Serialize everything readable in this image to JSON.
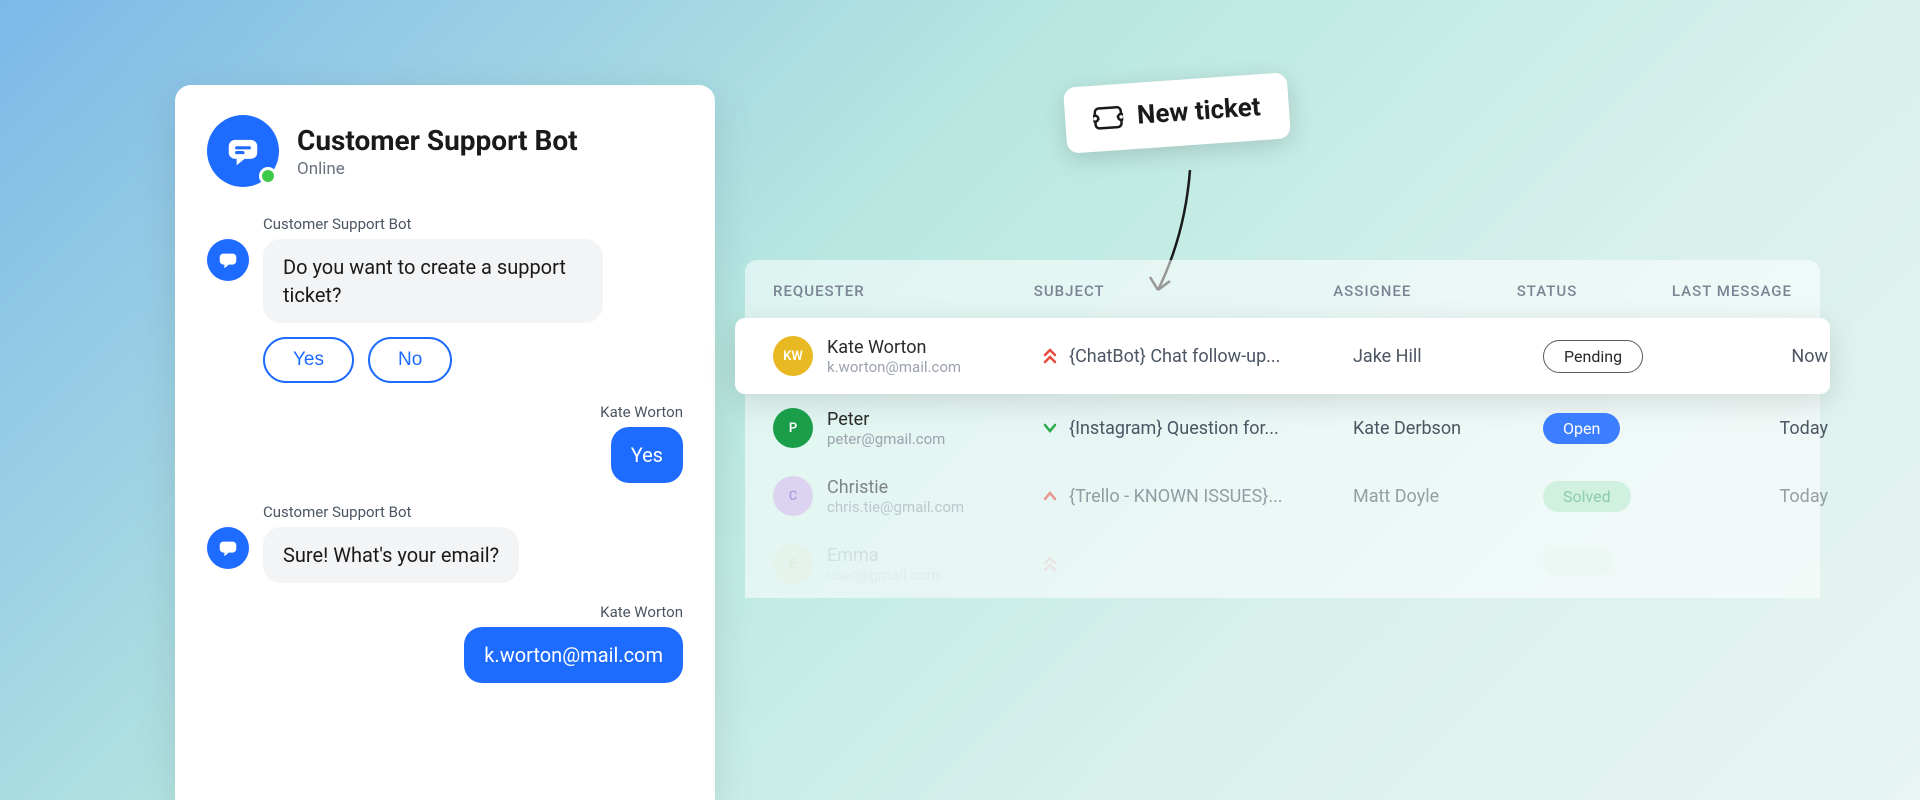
{
  "chat": {
    "bot_name": "Customer Support Bot",
    "status": "Online",
    "messages": [
      {
        "sender": "Customer Support Bot",
        "text": "Do you want to create a support ticket?"
      },
      {
        "sender": "Kate Worton",
        "text": "Yes"
      },
      {
        "sender": "Customer Support Bot",
        "text": "Sure! What's your email?"
      },
      {
        "sender": "Kate Worton",
        "text": "k.worton@mail.com"
      }
    ],
    "options": {
      "yes": "Yes",
      "no": "No"
    }
  },
  "callout": {
    "label": "New ticket"
  },
  "table": {
    "headers": {
      "requester": "REQUESTER",
      "subject": "SUBJECT",
      "assignee": "ASSIGNEE",
      "status": "STATUS",
      "last_message": "LAST MESSAGE"
    },
    "rows": [
      {
        "avatar": "KW",
        "avatar_color": "yellow",
        "name": "Kate Worton",
        "email": "k.worton@mail.com",
        "priority": "high-double",
        "subject": "{ChatBot} Chat follow-up...",
        "assignee": "Jake Hill",
        "status": "Pending",
        "status_kind": "pending",
        "last_message": "Now"
      },
      {
        "avatar": "P",
        "avatar_color": "green",
        "name": "Peter",
        "email": "peter@gmail.com",
        "priority": "low",
        "subject": "{Instagram} Question for...",
        "assignee": "Kate Derbson",
        "status": "Open",
        "status_kind": "open",
        "last_message": "Today"
      },
      {
        "avatar": "C",
        "avatar_color": "purple",
        "name": "Christie",
        "email": "chris.tie@gmail.com",
        "priority": "high",
        "subject": "{Trello - KNOWN ISSUES}...",
        "assignee": "Matt Doyle",
        "status": "Solved",
        "status_kind": "solved",
        "last_message": "Today"
      },
      {
        "avatar": "E",
        "avatar_color": "cream",
        "name": "Emma",
        "email": "user@gmail.com",
        "priority": "high-double",
        "subject": "",
        "assignee": "",
        "status": "",
        "status_kind": "blank",
        "last_message": ""
      }
    ]
  }
}
